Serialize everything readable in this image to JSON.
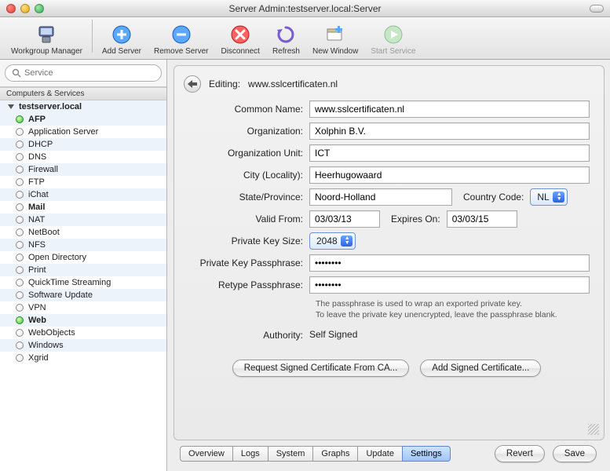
{
  "window": {
    "title": "Server Admin:testserver.local:Server"
  },
  "toolbar": {
    "workgroup": "Workgroup Manager",
    "add": "Add Server",
    "remove": "Remove Server",
    "disconnect": "Disconnect",
    "refresh": "Refresh",
    "newwin": "New Window",
    "start": "Start Service"
  },
  "search": {
    "placeholder": "Service"
  },
  "sidebar": {
    "section": "Computers & Services",
    "server": "testserver.local",
    "items": [
      {
        "label": "AFP",
        "on": true,
        "bold": true
      },
      {
        "label": "Application Server",
        "on": false
      },
      {
        "label": "DHCP",
        "on": false
      },
      {
        "label": "DNS",
        "on": false
      },
      {
        "label": "Firewall",
        "on": false
      },
      {
        "label": "FTP",
        "on": false
      },
      {
        "label": "iChat",
        "on": false
      },
      {
        "label": "Mail",
        "on": false,
        "bold": true
      },
      {
        "label": "NAT",
        "on": false
      },
      {
        "label": "NetBoot",
        "on": false
      },
      {
        "label": "NFS",
        "on": false
      },
      {
        "label": "Open Directory",
        "on": false
      },
      {
        "label": "Print",
        "on": false
      },
      {
        "label": "QuickTime Streaming",
        "on": false
      },
      {
        "label": "Software Update",
        "on": false
      },
      {
        "label": "VPN",
        "on": false
      },
      {
        "label": "Web",
        "on": true,
        "bold": true
      },
      {
        "label": "WebObjects",
        "on": false
      },
      {
        "label": "Windows",
        "on": false
      },
      {
        "label": "Xgrid",
        "on": false
      }
    ]
  },
  "form": {
    "editing_prefix": "Editing:",
    "editing_value": "www.sslcertificaten.nl",
    "labels": {
      "cn": "Common Name:",
      "org": "Organization:",
      "ou": "Organization Unit:",
      "city": "City (Locality):",
      "state": "State/Province:",
      "cc": "Country Code:",
      "valid": "Valid From:",
      "expires": "Expires On:",
      "keysize": "Private Key Size:",
      "pass": "Private Key Passphrase:",
      "repass": "Retype Passphrase:",
      "authority": "Authority:"
    },
    "values": {
      "cn": "www.sslcertificaten.nl",
      "org": "Xolphin B.V.",
      "ou": "ICT",
      "city": "Heerhugowaard",
      "state": "Noord-Holland",
      "cc": "NL",
      "valid": "03/03/13",
      "expires": "03/03/15",
      "keysize": "2048",
      "pass": "••••••••",
      "repass": "••••••••",
      "authority": "Self Signed"
    },
    "hint1": "The passphrase is used to wrap an exported private key.",
    "hint2": "To leave the private key unencrypted, leave the passphrase blank.",
    "request_btn": "Request Signed Certificate From CA...",
    "add_btn": "Add Signed Certificate..."
  },
  "tabs": {
    "overview": "Overview",
    "logs": "Logs",
    "system": "System",
    "graphs": "Graphs",
    "update": "Update",
    "settings": "Settings"
  },
  "footer": {
    "revert": "Revert",
    "save": "Save"
  }
}
